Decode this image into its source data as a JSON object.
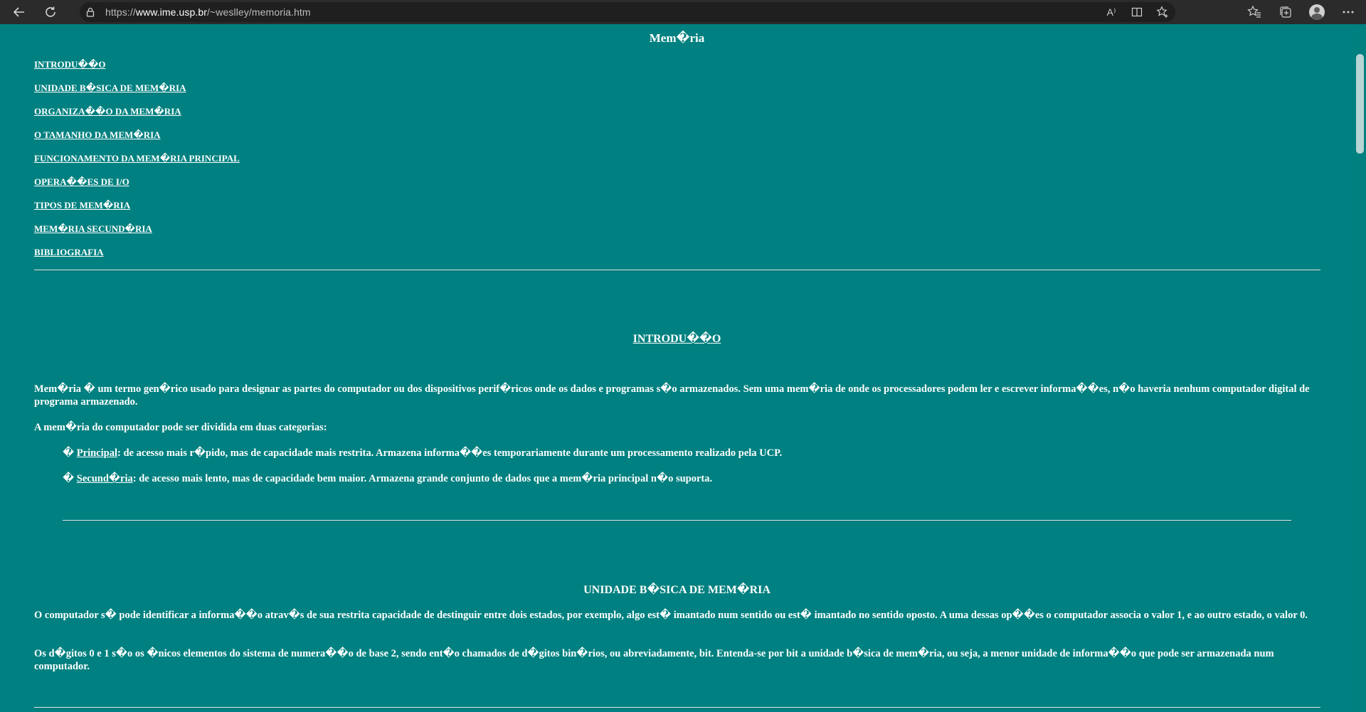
{
  "browser": {
    "url_prefix": "https://",
    "url_host": "www.ime.usp.br",
    "url_path": "/~weslley/memoria.htm",
    "read_aloud_label": "A⁾"
  },
  "page": {
    "title": "Mem�ria",
    "toc": [
      "INTRODU��O",
      "UNIDADE B�SICA DE MEM�RIA",
      "ORGANIZA��O DA MEM�RIA",
      "O TAMANHO DA MEM�RIA",
      "FUNCIONAMENTO DA MEM�RIA PRINCIPAL",
      "OPERA��ES DE I/O",
      "TIPOS DE MEM�RIA",
      "MEM�RIA SECUND�RIA",
      "BIBLIOGRAFIA"
    ],
    "intro": {
      "heading": "INTRODU��O",
      "p1": "Mem�ria � um termo gen�rico usado para designar as partes do computador ou dos dispositivos perif�ricos onde os dados e programas s�o armazenados. Sem uma mem�ria de onde os processadores podem ler e escrever informa��es, n�o haveria nenhum computador digital de programa armazenado.",
      "p2": "A mem�ria do computador pode ser dividida em duas categorias:",
      "b1_mark": "� ",
      "b1_term": "Principal",
      "b1_text": ": de acesso mais r�pido, mas de capacidade mais restrita. Armazena informa��es temporariamente durante um processamento realizado pela UCP.",
      "b2_mark": "� ",
      "b2_term": "Secund�ria",
      "b2_text": ": de acesso mais lento, mas de capacidade bem maior. Armazena grande conjunto de dados que a mem�ria principal n�o suporta."
    },
    "unit": {
      "heading": "UNIDADE B�SICA DE MEM�RIA",
      "p1": "O computador s� pode identificar a informa��o atrav�s de sua restrita capacidade de destinguir entre dois estados, por exemplo, algo est� imantado num sentido ou est� imantado no sentido oposto. A uma dessas op��es o computador associa o valor 1, e ao outro estado, o valor 0.",
      "p2": "Os d�gitos 0 e 1 s�o os �nicos elementos do sistema de numera��o de base 2, sendo ent�o chamados de d�gitos bin�rios, ou abreviadamente, bit. Entenda-se por bit a unidade b�sica de mem�ria, ou seja, a menor unidade de informa��o que pode ser armazenada num computador."
    }
  }
}
